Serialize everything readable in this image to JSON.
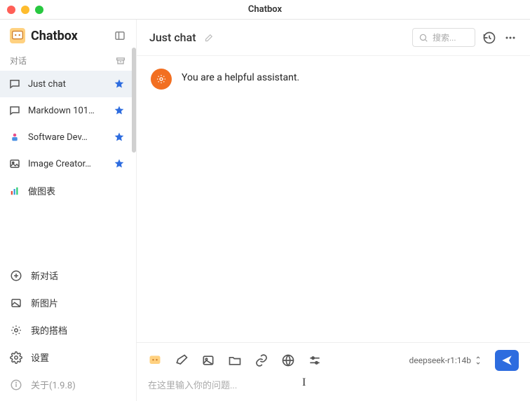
{
  "window": {
    "title": "Chatbox"
  },
  "sidebar": {
    "brand": "Chatbox",
    "section_label": "对话",
    "chats": [
      {
        "label": "Just chat",
        "starred": true,
        "icon": "chat"
      },
      {
        "label": "Markdown 101…",
        "starred": true,
        "icon": "chat"
      },
      {
        "label": "Software Dev…",
        "starred": true,
        "icon": "dev"
      },
      {
        "label": "Image Creator…",
        "starred": true,
        "icon": "image"
      },
      {
        "label": "做图表",
        "starred": false,
        "icon": "chart"
      }
    ],
    "actions": {
      "new_chat": "新对话",
      "new_image": "新图片",
      "my_copilots": "我的搭档",
      "settings": "设置",
      "about": "关于(1.9.8)"
    }
  },
  "main": {
    "chat_title": "Just chat",
    "search_placeholder": "搜索...",
    "system_message": "You are a helpful assistant."
  },
  "composer": {
    "model": "deepseek-r1:14b",
    "placeholder": "在这里输入你的问题..."
  }
}
